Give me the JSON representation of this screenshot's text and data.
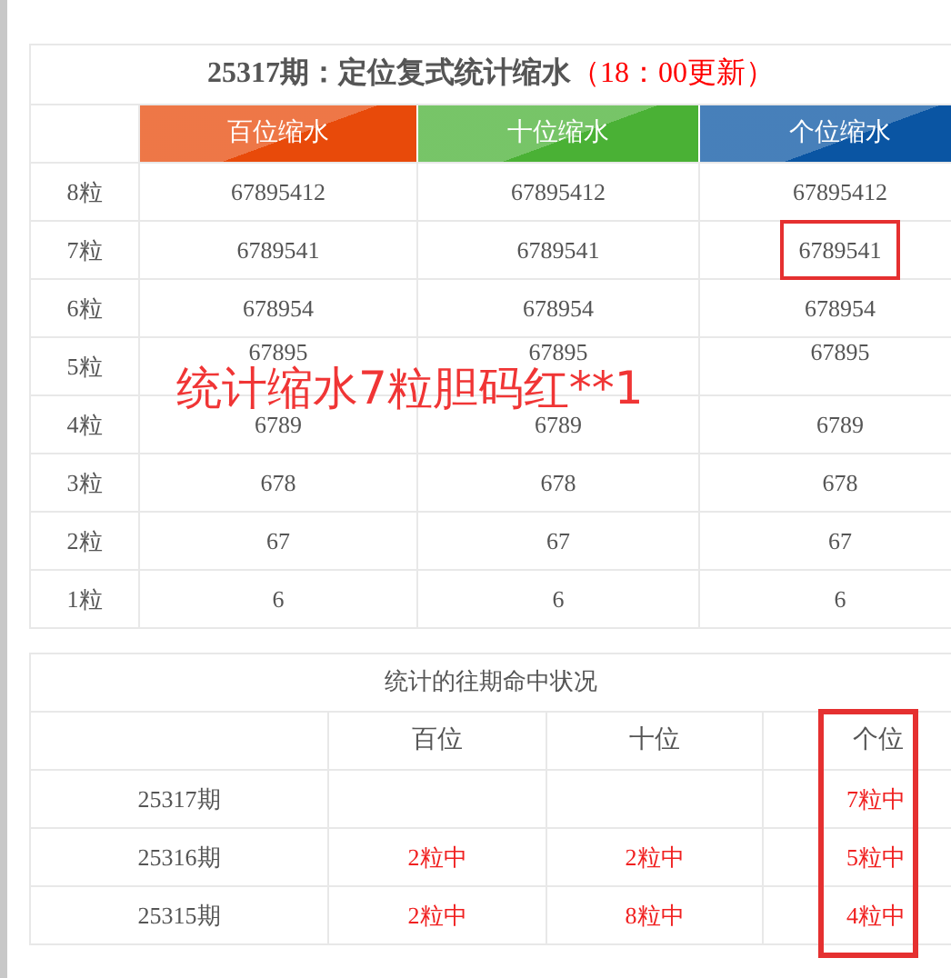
{
  "stats_table": {
    "title": "25317期：定位复式统计缩水",
    "update_note": "（18：00更新）",
    "columns": [
      {
        "label": "百位缩水",
        "color": "#e84a0a"
      },
      {
        "label": "十位缩水",
        "color": "#4ab135"
      },
      {
        "label": "个位缩水",
        "color": "#0a55a3"
      }
    ],
    "rows": [
      {
        "label": "8粒",
        "cells": [
          {
            "value": "67895412",
            "circled": false
          },
          {
            "value": "67895412",
            "circled": false
          },
          {
            "value": "67895412",
            "circled": false
          }
        ]
      },
      {
        "label": "7粒",
        "cells": [
          {
            "value": "6789541",
            "circled": false
          },
          {
            "value": "6789541",
            "circled": false
          },
          {
            "value": "6789541",
            "circled": true
          }
        ]
      },
      {
        "label": "6粒",
        "cells": [
          {
            "value": "678954",
            "circled": false
          },
          {
            "value": "678954",
            "circled": false
          },
          {
            "value": "678954",
            "circled": false
          }
        ]
      },
      {
        "label": "5粒",
        "cells": [
          {
            "value": "67895",
            "circled": false
          },
          {
            "value": "67895",
            "circled": false
          },
          {
            "value": "67895",
            "circled": false
          }
        ]
      },
      {
        "label": "4粒",
        "cells": [
          {
            "value": "6789",
            "circled": false
          },
          {
            "value": "6789",
            "circled": false
          },
          {
            "value": "6789",
            "circled": false
          }
        ]
      },
      {
        "label": "3粒",
        "cells": [
          {
            "value": "678",
            "circled": false
          },
          {
            "value": "678",
            "circled": false
          },
          {
            "value": "678",
            "circled": false
          }
        ]
      },
      {
        "label": "2粒",
        "cells": [
          {
            "value": "67",
            "circled": false
          },
          {
            "value": "67",
            "circled": false
          },
          {
            "value": "67",
            "circled": false
          }
        ]
      },
      {
        "label": "1粒",
        "cells": [
          {
            "value": "6",
            "circled": false
          },
          {
            "value": "6",
            "circled": false
          },
          {
            "value": "6",
            "circled": false
          }
        ]
      }
    ]
  },
  "annotation": "统计缩水7粒胆码红**1",
  "history_table": {
    "title": "统计的往期命中状况",
    "columns": [
      {
        "label": "百位",
        "circled": false
      },
      {
        "label": "十位",
        "circled": false
      },
      {
        "label": "个位",
        "circled": true
      }
    ],
    "rows": [
      {
        "period": "25317期",
        "units": "7粒中"
      },
      {
        "period": "25316期",
        "hundreds": "2粒中",
        "tens": "2粒中",
        "units": "5粒中"
      },
      {
        "period": "25315期",
        "hundreds": "2粒中",
        "tens": "8粒中",
        "units": "4粒中"
      }
    ]
  }
}
